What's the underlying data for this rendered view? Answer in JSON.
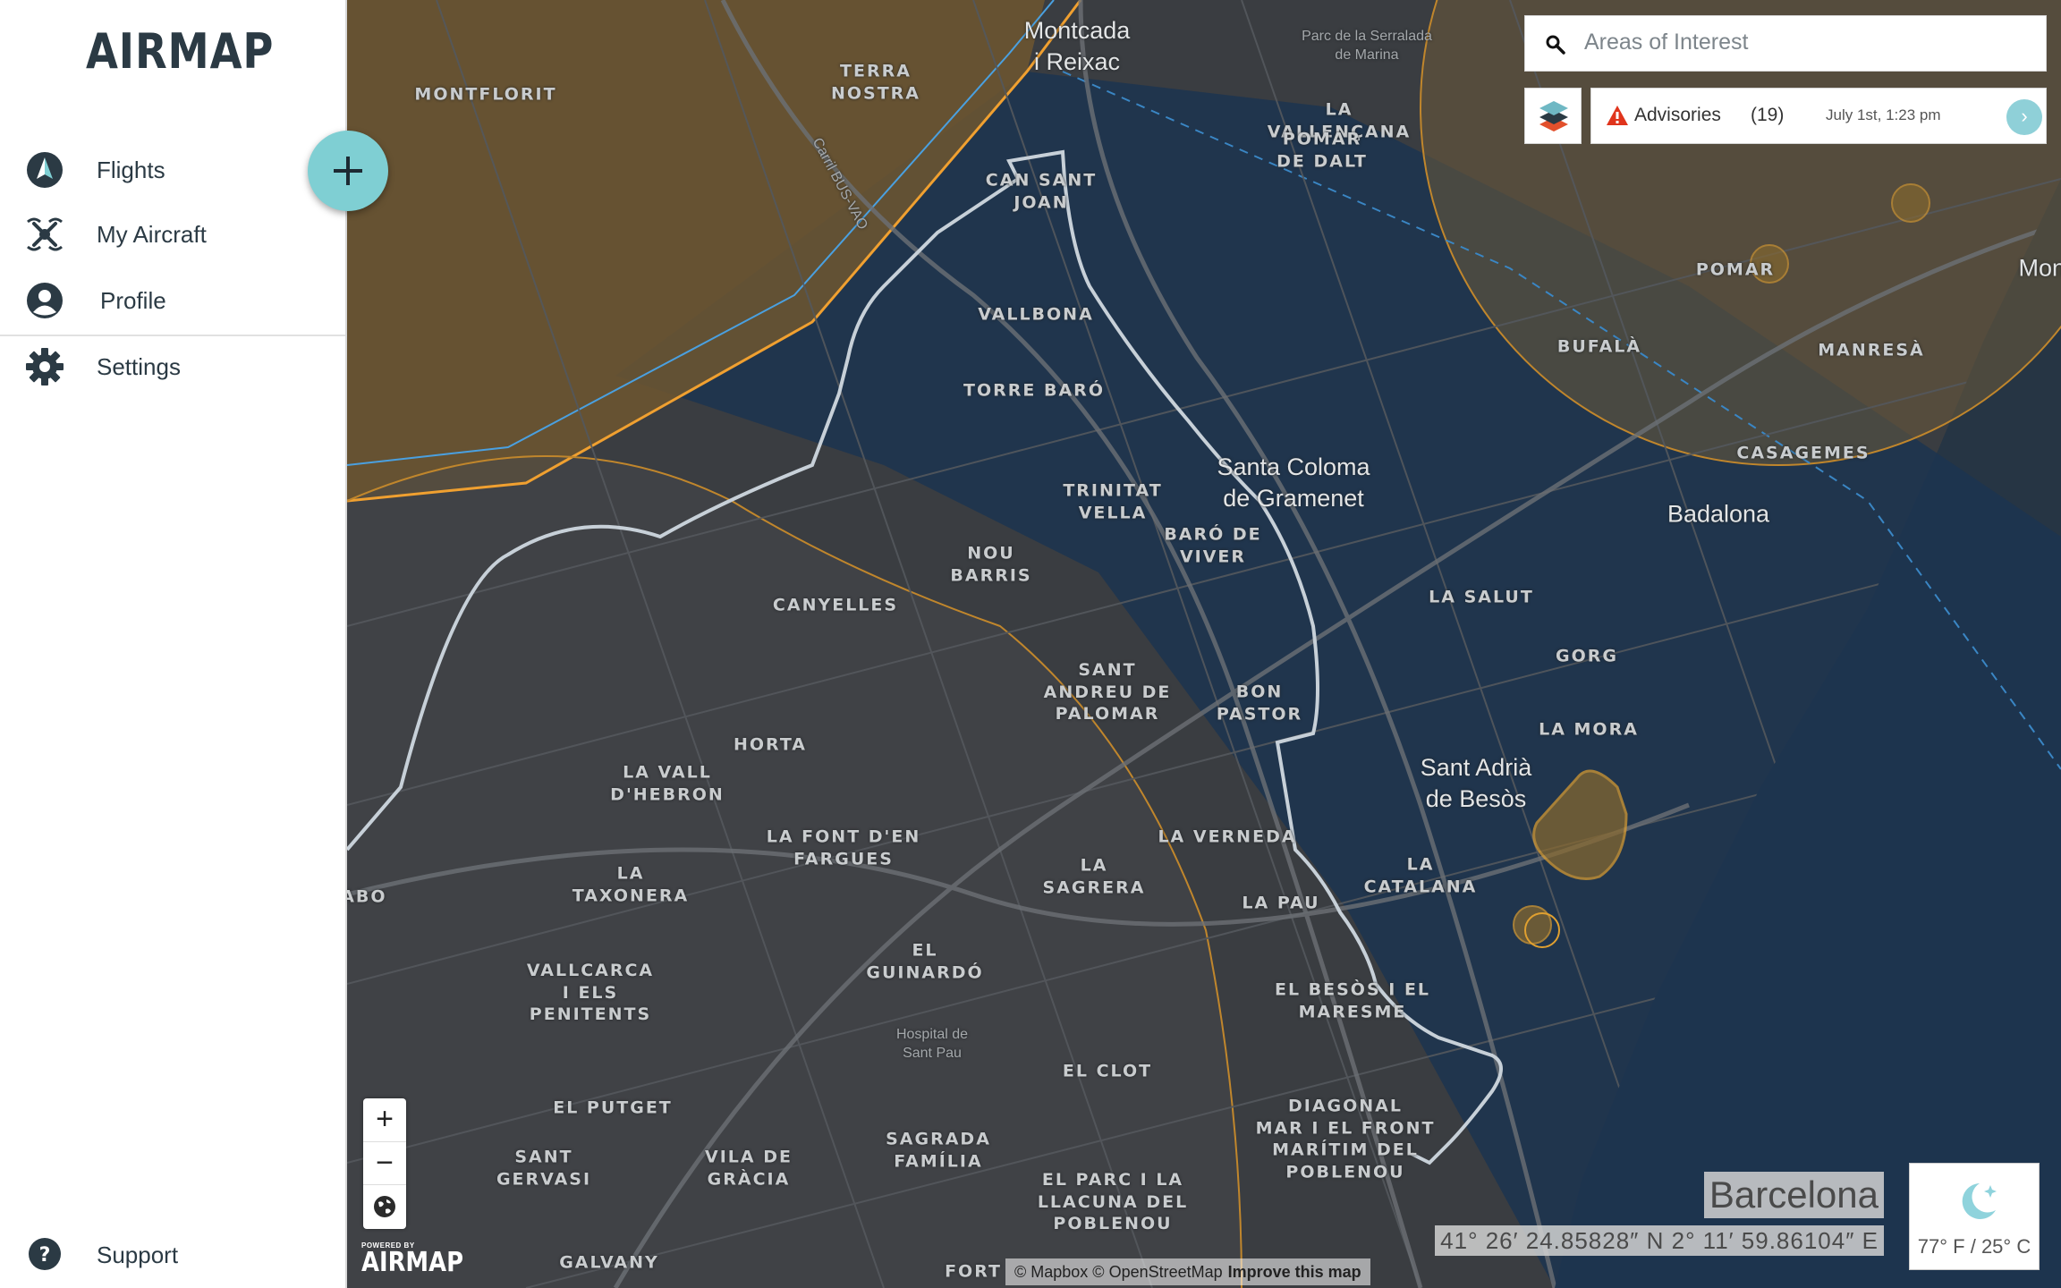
{
  "app": {
    "logo": "AIRMAP",
    "powered_by": "POWERED BY",
    "powered_logo": "AIRMAP"
  },
  "sidebar": {
    "items": [
      {
        "label": "Flights",
        "icon": "flights-icon"
      },
      {
        "label": "My Aircraft",
        "icon": "drone-icon"
      },
      {
        "label": "Profile",
        "icon": "user-icon"
      },
      {
        "label": "Settings",
        "icon": "gear-icon"
      }
    ],
    "support": {
      "label": "Support",
      "icon": "help-icon"
    },
    "add_button_icon": "plus-icon"
  },
  "search": {
    "placeholder": "Areas of Interest",
    "value": ""
  },
  "advisories": {
    "label": "Advisories",
    "count": "(19)",
    "time": "July 1st, 1:23 pm",
    "go": "›"
  },
  "map": {
    "labels": [
      {
        "text": "Montcada\ni Reixac",
        "kind": "city"
      },
      {
        "text": "MONTFLORIT",
        "kind": "hood"
      },
      {
        "text": "TERRA\nNOSTRA",
        "kind": "hood"
      },
      {
        "text": "Carril BUS-VAO",
        "kind": "small"
      },
      {
        "text": "Parc de la Serralada\nde Marina",
        "kind": "small"
      },
      {
        "text": "LA\nVALLENÇANA",
        "kind": "hood"
      },
      {
        "text": "POMAR\nDE DALT",
        "kind": "hood"
      },
      {
        "text": "CAN SANT\nJOAN",
        "kind": "hood"
      },
      {
        "text": "VALLBONA",
        "kind": "hood"
      },
      {
        "text": "TORRE BARÓ",
        "kind": "hood"
      },
      {
        "text": "POMAR",
        "kind": "hood"
      },
      {
        "text": "BUFALÀ",
        "kind": "hood"
      },
      {
        "text": "MANRESÀ",
        "kind": "hood"
      },
      {
        "text": "Montg",
        "kind": "city"
      },
      {
        "text": "Santa Coloma\nde Gramenet",
        "kind": "city"
      },
      {
        "text": "CASAGEMES",
        "kind": "hood"
      },
      {
        "text": "Badalona",
        "kind": "city"
      },
      {
        "text": "TRINITAT\nVELLA",
        "kind": "hood"
      },
      {
        "text": "BARÓ DE\nVIVER",
        "kind": "hood"
      },
      {
        "text": "NOU\nBARRIS",
        "kind": "hood"
      },
      {
        "text": "CANYELLES",
        "kind": "hood"
      },
      {
        "text": "LA SALUT",
        "kind": "hood"
      },
      {
        "text": "GORG",
        "kind": "hood"
      },
      {
        "text": "SANT\nANDREU DE\nPALOMAR",
        "kind": "hood"
      },
      {
        "text": "BON\nPASTOR",
        "kind": "hood"
      },
      {
        "text": "LA MORA",
        "kind": "hood"
      },
      {
        "text": "HORTA",
        "kind": "hood"
      },
      {
        "text": "Sant Adrià\nde Besòs",
        "kind": "city"
      },
      {
        "text": "LA VALL\nD'HEBRON",
        "kind": "hood"
      },
      {
        "text": "LA FONT D'EN\nFARGUES",
        "kind": "hood"
      },
      {
        "text": "LA VERNEDA",
        "kind": "hood"
      },
      {
        "text": "LA\nSAGRERA",
        "kind": "hood"
      },
      {
        "text": "LA\nCATALANA",
        "kind": "hood"
      },
      {
        "text": "LA\nTAXONERA",
        "kind": "hood"
      },
      {
        "text": "DABO",
        "kind": "hood"
      },
      {
        "text": "LA PAU",
        "kind": "hood"
      },
      {
        "text": "EL\nGUINARDÓ",
        "kind": "hood"
      },
      {
        "text": "VALLCARCA\nI ELS\nPENITENTS",
        "kind": "hood"
      },
      {
        "text": "EL BESÒS I EL\nMARESME",
        "kind": "hood"
      },
      {
        "text": "Hospital de\nSant Pau",
        "kind": "small"
      },
      {
        "text": "EL CLOT",
        "kind": "hood"
      },
      {
        "text": "EL PUTGET",
        "kind": "hood"
      },
      {
        "text": "DIAGONAL\nMAR I EL FRONT\nMARÍTIM DEL\nPOBLENOU",
        "kind": "hood"
      },
      {
        "text": "SANT\nGERVASI",
        "kind": "hood"
      },
      {
        "text": "VILA DE\nGRÀCIA",
        "kind": "hood"
      },
      {
        "text": "SAGRADA\nFAMÍLIA",
        "kind": "hood"
      },
      {
        "text": "EL PARC I LA\nLLACUNA DEL\nPOBLENOU",
        "kind": "hood"
      },
      {
        "text": "GALVANY",
        "kind": "hood"
      },
      {
        "text": "FORT",
        "kind": "hood"
      }
    ],
    "zoom_in": "+",
    "zoom_out": "−",
    "globe_icon": "globe-icon",
    "attribution": "© Mapbox © OpenStreetMap",
    "improve": "Improve this map"
  },
  "location": {
    "name": "Barcelona",
    "coords": "41° 26′ 24.85828″ N 2° 11′ 59.86104″ E"
  },
  "weather": {
    "icon": "moon-stars-icon",
    "temp": "77° F / 25° C"
  },
  "colors": {
    "accent": "#7fcfd3",
    "controlled_airspace": "#1e3a5c",
    "restricted_zone": "#8a6a2e",
    "border_line": "#c7d0d8",
    "sidebar_text": "#2b3a44"
  }
}
